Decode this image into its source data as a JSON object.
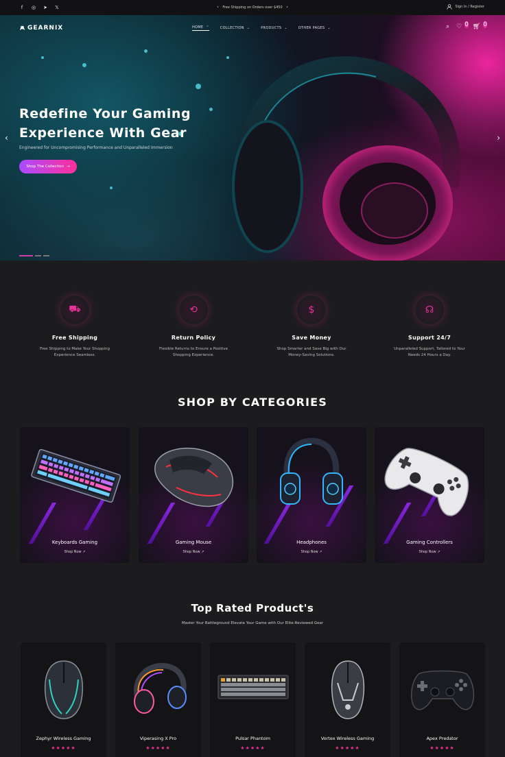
{
  "topbar": {
    "social": [
      "facebook-icon",
      "instagram-icon",
      "telegram-icon",
      "x-icon"
    ],
    "promo": "Free Shipping  on Orders over $450",
    "account": "Sign In / Register"
  },
  "nav": {
    "brand": "GEARNIX",
    "menu": [
      {
        "label": "HOME",
        "active": true
      },
      {
        "label": "COLLECTION"
      },
      {
        "label": "PRODUCTS"
      },
      {
        "label": "OTHER PAGES"
      }
    ],
    "wishlist_count": "0",
    "cart_count": "0"
  },
  "hero": {
    "title_line1": "Redefine Your Gaming",
    "title_line2": "Experience With Gear",
    "subtitle": "Engineered for Uncompromising Performance and Unparalleled Immersion",
    "cta": "Shop The Collection",
    "slides": 3,
    "active_slide": 1
  },
  "features": [
    {
      "icon": "truck-icon",
      "title": "Free Shipping",
      "desc1": "Free Shipping to Make Your Shopping",
      "desc2": "Experience Seamless."
    },
    {
      "icon": "return-icon",
      "title": "Return Policy",
      "desc1": "Flexible Returns to Ensure a Positive",
      "desc2": "Shopping Experience."
    },
    {
      "icon": "piggy-bank-icon",
      "title": "Save Money",
      "desc1": "Shop Smarter and Save Big with Our",
      "desc2": "Money-Saving Solutions."
    },
    {
      "icon": "headset-icon",
      "title": "Support 24/7",
      "desc1": "Unparalleled Support, Tailored to Your",
      "desc2": "Needs 24 Hours a Day."
    }
  ],
  "categories": {
    "title": "SHOP BY CATEGORIES",
    "items": [
      {
        "name": "Keyboards Gaming",
        "link": "Shop Now"
      },
      {
        "name": "Gaming Mouse",
        "link": "Shop Now"
      },
      {
        "name": "Headphones",
        "link": "Shop Now"
      },
      {
        "name": "Gaming Controllers",
        "link": "Shop Now"
      }
    ]
  },
  "top_rated": {
    "title": "Top Rated Product's",
    "subtitle": "Master Your Battleground Elevate Your Game with Our Elite-Reviewed Gear",
    "products": [
      {
        "name": "Zephyr Wireless Gaming",
        "rating": 5
      },
      {
        "name": "Viperasing X Pro",
        "rating": 5
      },
      {
        "name": "Pulsar Phantom",
        "rating": 5
      },
      {
        "name": "Vortex Wireless Gaming",
        "rating": 5
      },
      {
        "name": "Apex Predator",
        "rating": 5
      }
    ]
  },
  "colors": {
    "accent": "#e8329b",
    "accent2": "#a94cff",
    "bg": "#1c1c1f"
  }
}
